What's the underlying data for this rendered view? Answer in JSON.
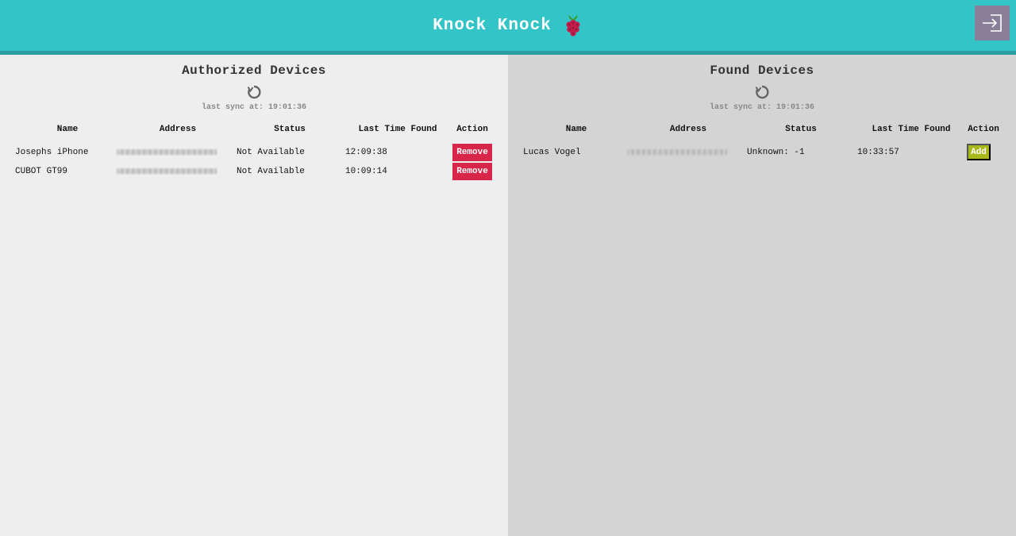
{
  "header": {
    "title": "Knock Knock",
    "logo_icon": "raspberry-pi-icon",
    "logout_icon": "sign-in-icon",
    "colors": {
      "header_bg": "#33c4c8",
      "header_border": "#2a9ea3",
      "logout_bg": "#8a7f98"
    }
  },
  "authorized": {
    "title": "Authorized Devices",
    "sync_icon": "refresh-icon",
    "sync_text": "last sync at: 19:01:36",
    "columns": [
      "Name",
      "Address",
      "Status",
      "Last Time Found",
      "Action"
    ],
    "rows": [
      {
        "name": "Josephs iPhone",
        "status": "Not Available",
        "last_found": "12:09:38",
        "action": "Remove"
      },
      {
        "name": "CUBOT GT99",
        "status": "Not Available",
        "last_found": "10:09:14",
        "action": "Remove"
      }
    ],
    "colors": {
      "panel_bg": "#eeeeee",
      "remove_bg": "#d8264a"
    }
  },
  "found": {
    "title": "Found Devices",
    "sync_icon": "refresh-icon",
    "sync_text": "last sync at: 19:01:36",
    "columns": [
      "Name",
      "Address",
      "Status",
      "Last Time Found",
      "Action"
    ],
    "rows": [
      {
        "name": "Lucas Vogel",
        "status": "Unknown: -1",
        "last_found": "10:33:57",
        "action": "Add"
      }
    ],
    "colors": {
      "panel_bg": "#d4d4d4",
      "add_bg": "#a8b81a"
    }
  }
}
